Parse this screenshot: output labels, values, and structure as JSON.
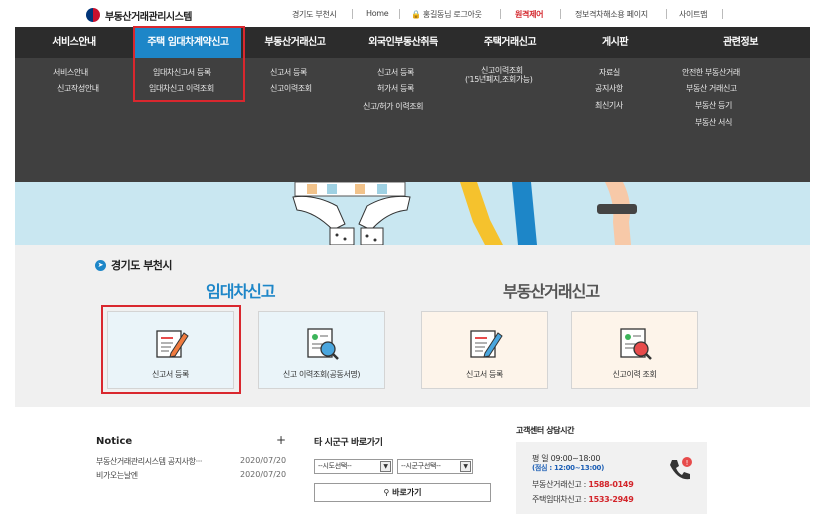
{
  "brand": {
    "logo_text": "부동산거래관리시스템"
  },
  "utility": {
    "region": "경기도 부천시",
    "home": "Home",
    "logout": "홍길동님 로그아웃",
    "remote": "원격제어",
    "info_page": "정보격차해소용 페이지",
    "sitemap": "사이트맵"
  },
  "gnb": [
    {
      "label": "서비스안내",
      "sub": [
        "서비스안내",
        "신고작성안내"
      ]
    },
    {
      "label": "주택 임대차계약신고",
      "sub": [
        "임대차신고서 등록",
        "임대차신고 이력조회"
      ]
    },
    {
      "label": "부동산거래신고",
      "sub": [
        "신고서 등록",
        "신고이력조회"
      ]
    },
    {
      "label": "외국인부동산취득",
      "sub": [
        "신고서 등록",
        "허가서 등록",
        "신고/허가 이력조회"
      ]
    },
    {
      "label": "주택거래신고",
      "sub": [
        "신고이력조회",
        "('15년폐지,조회가능)"
      ]
    },
    {
      "label": "게시판",
      "sub": [
        "자료실",
        "공지사항",
        "최신기사"
      ]
    },
    {
      "label": "관련정보",
      "sub": [
        "안전한 부동산거래",
        "부동산 거래신고",
        "부동산 등기",
        "부동산 서식"
      ]
    }
  ],
  "main": {
    "region_title": "경기도 부천시",
    "lease_title": "임대차신고",
    "trade_title": "부동산거래신고",
    "cards": [
      {
        "label": "신고서 등록",
        "icon": "edit-document-icon"
      },
      {
        "label": "신고 이력조회(공동서명)",
        "icon": "search-profile-icon"
      },
      {
        "label": "신고서 등록",
        "icon": "edit-document-icon"
      },
      {
        "label": "신고이력 조회",
        "icon": "search-profile-icon"
      }
    ]
  },
  "notice": {
    "title": "Notice",
    "more": "+",
    "items": [
      {
        "text": "부동산거래관리시스템 공지사항···",
        "date": "2020/07/20"
      },
      {
        "text": "비가오는날엔",
        "date": "2020/07/20"
      }
    ]
  },
  "goto": {
    "title": "타 시군구 바로가기",
    "sido": "--시도선택--",
    "sigungu": "--시군구선택--",
    "button": "바로가기"
  },
  "support": {
    "title": "고객센터 상담시간",
    "weekday": "평 일  09:00~18:00",
    "lunch": "(점심 : 12:00~13:00)",
    "trade_label": "부동산거래신고 : ",
    "trade_num": "1588-0149",
    "lease_label": "주택임대차신고 : ",
    "lease_num": "1533-2949"
  },
  "colors": {
    "accent": "#1d86c8",
    "lease_title": "#1d86c8",
    "trade_title": "#555555",
    "highlight": "#d9272e",
    "nav_bg": "#2c2c2c"
  }
}
